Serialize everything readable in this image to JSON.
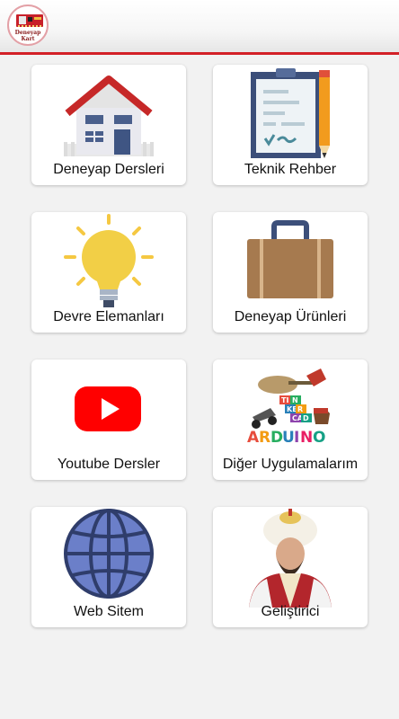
{
  "app": {
    "logo_line1": "Deneyap",
    "logo_line2": "Kart"
  },
  "menu": [
    {
      "label": "Deneyap Dersleri",
      "icon": "house-icon"
    },
    {
      "label": "Teknik Rehber",
      "icon": "clipboard-pencil-icon"
    },
    {
      "label": "Devre Elemanları",
      "icon": "lightbulb-icon"
    },
    {
      "label": "Deneyap Ürünleri",
      "icon": "briefcase-icon"
    },
    {
      "label": "Youtube Dersler",
      "icon": "youtube-icon"
    },
    {
      "label": "Diğer Uygulamalarım",
      "icon": "tinkercad-arduino-icon"
    },
    {
      "label": "Web Sitem",
      "icon": "globe-icon"
    },
    {
      "label": "Geliştirici",
      "icon": "developer-portrait-icon"
    }
  ],
  "colors": {
    "accent": "#d32027",
    "youtube_red": "#ff0000",
    "globe_blue": "#6b7fc9"
  }
}
